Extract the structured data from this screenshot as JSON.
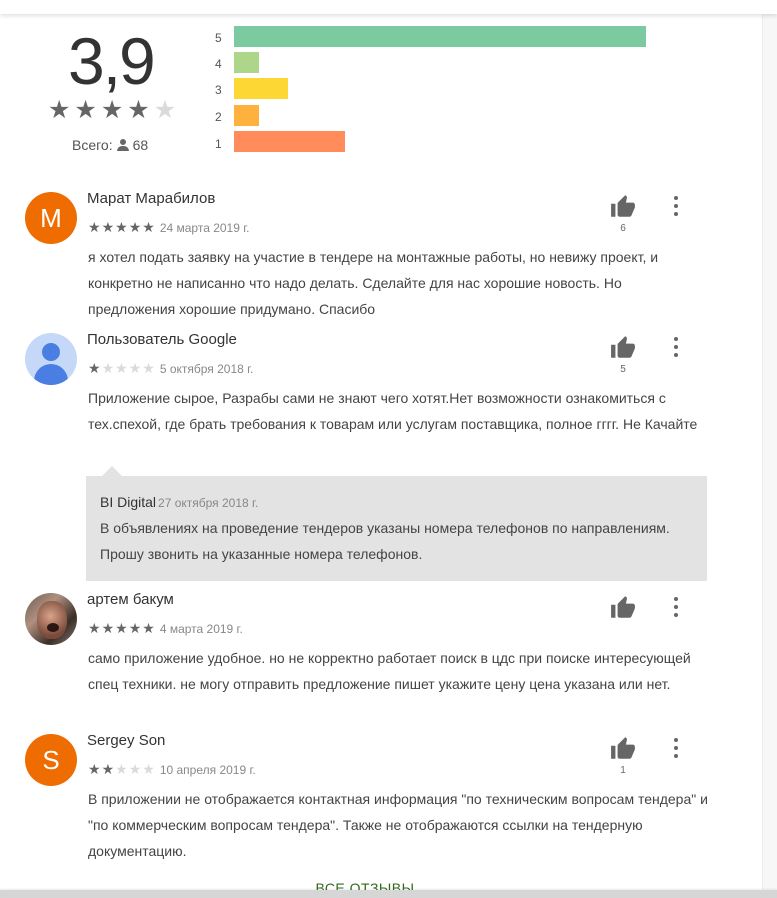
{
  "summary": {
    "score": "3,9",
    "stars_filled": 4,
    "total_label": "Всего:",
    "total_count": "68"
  },
  "histogram": [
    {
      "label": "5",
      "fraction": 1.0,
      "color": "#7ccba0"
    },
    {
      "label": "4",
      "fraction": 0.06,
      "color": "#aed68a"
    },
    {
      "label": "3",
      "fraction": 0.13,
      "color": "#fdd835"
    },
    {
      "label": "2",
      "fraction": 0.06,
      "color": "#ffb13e"
    },
    {
      "label": "1",
      "fraction": 0.27,
      "color": "#ff8c5a"
    }
  ],
  "reviews": [
    {
      "author": "Марат Марабилов",
      "rating": 5,
      "date": "24 марта 2019 г.",
      "likes": "6",
      "avatar_letter": "M",
      "text": "я хотел подать заявку на участие в тендере на монтажные работы, но невижу проект, и конкретно не написанно что надо делать. Сделайте для нас хорошие новость. Но предложения хорошие придумано. Спасибо"
    },
    {
      "author": "Пользователь Google",
      "rating": 1,
      "date": "5 октября 2018 г.",
      "likes": "5",
      "text": "Приложение сырое, Разрабы сами не знают чего хотят.Нет возможности ознакомиться с тех.спехой, где брать требования к товарам или услугам поставщика, полное гггг. Не Качайте",
      "reply": {
        "author": "BI Digital",
        "date": "27 октября 2018 г.",
        "text": "В объявлениях на проведение тендеров указаны номера телефонов по направлениям. Прошу звонить на указанные номера телефонов."
      }
    },
    {
      "author": "артем бакум",
      "rating": 5,
      "date": "4 марта 2019 г.",
      "likes": "",
      "text": "само приложение удобное. но не корректно работает поиск в цдс при поиске интересующей спец техники. не могу отправить предложение пишет укажите цену цена указана или нет."
    },
    {
      "author": "Sergey Son",
      "rating": 2,
      "date": "10 апреля 2019 г.",
      "likes": "1",
      "avatar_letter": "S",
      "text": "В приложении не отображается контактная информация \"по техническим вопросам тендера\" и \"по коммерческим вопросам тендера\". Также не отображаются ссылки на тендерную документацию."
    }
  ],
  "all_reviews_label": "ВСЕ ОТЗЫВЫ",
  "colors": {
    "star_filled": "#666666",
    "star_empty": "#dadada",
    "orange_avatar": "#ef6c00",
    "link_green": "#33691e"
  },
  "icons": [
    "thumb-up-icon",
    "more-vert-icon",
    "star-icon",
    "person-icon"
  ]
}
